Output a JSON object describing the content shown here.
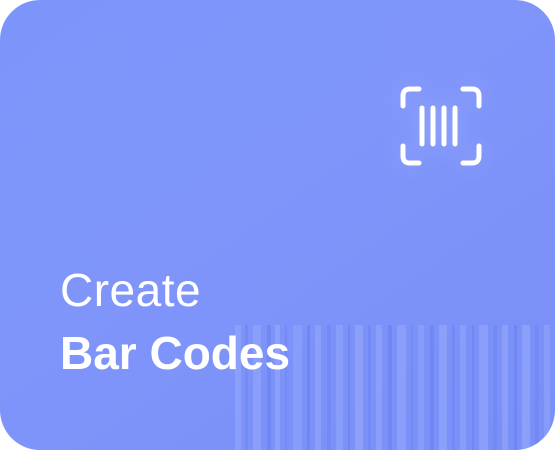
{
  "card": {
    "title_line1": "Create",
    "title_line2": "Bar Codes"
  },
  "icons": {
    "main": "barcode-scan-icon",
    "background": "barcode-stripes"
  },
  "colors": {
    "card_background": "#7f95fa",
    "text": "#ffffff",
    "stripe_light": "#8fa3fb",
    "stripe_dark": "#6d84f3"
  }
}
